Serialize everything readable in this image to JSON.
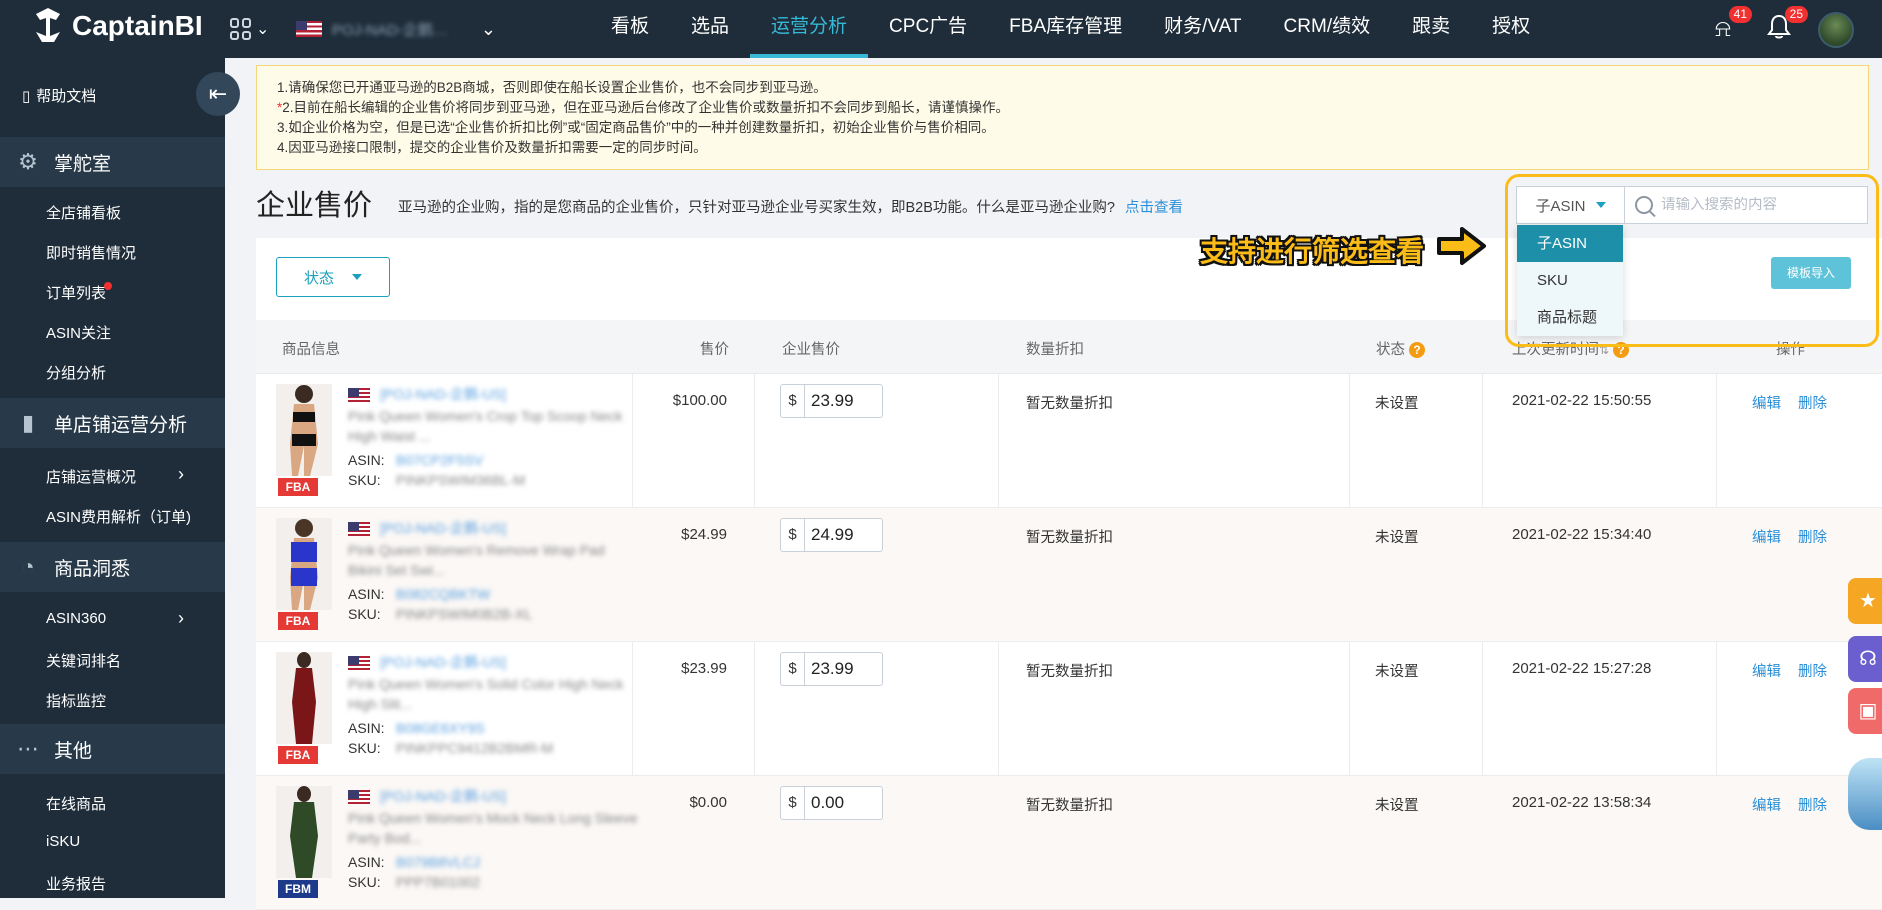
{
  "brand": {
    "name": "CaptainBI"
  },
  "topbar": {
    "store_name": "POJ-NAD-企鹅…",
    "menu": [
      "看板",
      "选品",
      "运营分析",
      "CPC广告",
      "FBA库存管理",
      "财务/VAT",
      "CRM/绩效",
      "跟卖",
      "授权"
    ],
    "active_menu": "运营分析",
    "alert_count": "41",
    "notify_count": "25"
  },
  "sidebar": {
    "help": "帮助文档",
    "sections": [
      {
        "label": "掌舵室",
        "icon": "gear-icon",
        "items": [
          "全店铺看板",
          "即时销售情况",
          "订单列表",
          "ASIN关注",
          "分组分析"
        ]
      },
      {
        "label": "单店铺运营分析",
        "icon": "bar-chart-icon",
        "items": [
          "店铺运营概况",
          "ASIN费用解析（订单)"
        ]
      },
      {
        "label": "商品洞悉",
        "icon": "pie-chart-icon",
        "items": [
          "ASIN360",
          "关键词排名",
          "指标监控"
        ]
      },
      {
        "label": "其他",
        "icon": "more-icon",
        "items": [
          "在线商品",
          "iSKU",
          "业务报告"
        ]
      }
    ]
  },
  "notice": {
    "lines": [
      "1.请确保您已开通亚马逊的B2B商城，否则即使在船长设置企业售价，也不会同步到亚马逊。",
      "2.目前在船长编辑的企业售价将同步到亚马逊，但在亚马逊后台修改了企业售价或数量折扣不会同步到船长，请谨慎操作。",
      "3.如企业价格为空，但是已选“企业售价折扣比例”或“固定商品售价”中的一种并创建数量折扣，初始企业售价与售价相同。",
      "4.因亚马逊接口限制，提交的企业售价及数量折扣需要一定的同步时间。"
    ],
    "star": "*"
  },
  "page": {
    "title": "企业售价",
    "desc": "亚马逊的企业购，指的是您商品的企业售价，只针对亚马逊企业号买家生效，即B2B功能。什么是亚马逊企业购?",
    "desc_link": "点击查看"
  },
  "search": {
    "type": "子ASIN",
    "placeholder": "请输入搜索的内容",
    "options": [
      "子ASIN",
      "SKU",
      "商品标题"
    ]
  },
  "annotation": "支持进行筛选查看",
  "toolbar": {
    "status_label": "状态",
    "import_label": "模板导入"
  },
  "table": {
    "headers": [
      "商品信息",
      "售价",
      "企业售价",
      "数量折扣",
      "状态",
      "上次更新时间",
      "操作"
    ],
    "asin_label": "ASIN:",
    "sku_label": "SKU:",
    "rows": [
      {
        "id": "[POJ-NAD-企鹅-US]",
        "name": "Pink Queen Women's Crop Top Scoop Neck High Waist ...",
        "asin": "B07CP2F5SV",
        "sku": "PINKPSWIM36BL-M",
        "price": "$100.00",
        "currency": "$",
        "biz_price": "23.99",
        "qty": "暂无数量折扣",
        "status": "未设置",
        "time": "2021-02-22 15:50:55",
        "fulfil": "FBA",
        "edit": "编辑",
        "del": "删除"
      },
      {
        "id": "[POJ-NAD-企鹅-US]",
        "name": "Pink Queen Women's Remove Wrap Pad Bikini Set Swi...",
        "asin": "B082CQBKTW",
        "sku": "PINKPSWIM0B2B-XL",
        "price": "$24.99",
        "currency": "$",
        "biz_price": "24.99",
        "qty": "暂无数量折扣",
        "status": "未设置",
        "time": "2021-02-22 15:34:40",
        "fulfil": "FBA",
        "edit": "编辑",
        "del": "删除"
      },
      {
        "id": "[POJ-NAD-企鹅-US]",
        "name": "Pink Queen Women's Solid Color High Neck High Slit...",
        "asin": "B08GE6XY9S",
        "sku": "PINKPPC9412B2BMR-M",
        "price": "$23.99",
        "currency": "$",
        "biz_price": "23.99",
        "qty": "暂无数量折扣",
        "status": "未设置",
        "time": "2021-02-22 15:27:28",
        "fulfil": "FBA",
        "edit": "编辑",
        "del": "删除"
      },
      {
        "id": "[POJ-NAD-企鹅-US]",
        "name": "Pink Queen Women's Mock Neck Long Sleeve Party Bod...",
        "asin": "B079B8VLCJ",
        "sku": "PPP7B01002",
        "price": "$0.00",
        "currency": "$",
        "biz_price": "0.00",
        "qty": "暂无数量折扣",
        "status": "未设置",
        "time": "2021-02-22 13:58:34",
        "fulfil": "FBM",
        "edit": "编辑",
        "del": "删除"
      }
    ]
  },
  "colors": {
    "nav_bg": "#1f2d3a",
    "accent": "#35b9d6",
    "highlight": "#fbbc18",
    "fba": "#e53935",
    "fbm": "#1e3a8a",
    "swatches": [
      "#111111",
      "#2a35c9",
      "#7a1518",
      "#2e4a26"
    ]
  }
}
